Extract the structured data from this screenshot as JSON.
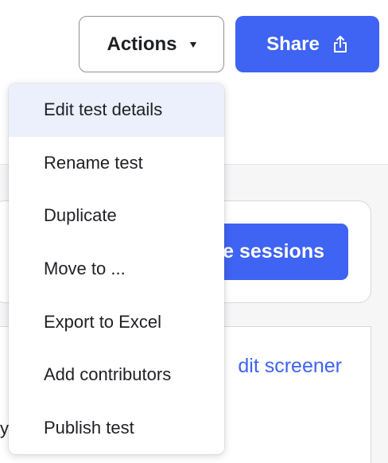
{
  "toolbar": {
    "actions_label": "Actions",
    "share_label": "Share"
  },
  "menu": {
    "items": [
      {
        "label": "Edit test details",
        "active": true
      },
      {
        "label": "Rename test"
      },
      {
        "label": "Duplicate"
      },
      {
        "label": "Move to ..."
      },
      {
        "label": "Export to Excel"
      },
      {
        "label": "Add contributors"
      },
      {
        "label": "Publish test"
      }
    ]
  },
  "background": {
    "sessions_button_label": "e sessions",
    "screener_link_label": "dit screener",
    "left_fragment": "y"
  },
  "icons": {
    "actions_caret": "caret-down-icon",
    "share": "share-upload-icon"
  },
  "colors": {
    "primary": "#3f63f2",
    "menu_highlight": "#eceffc",
    "text": "#1f2024"
  }
}
